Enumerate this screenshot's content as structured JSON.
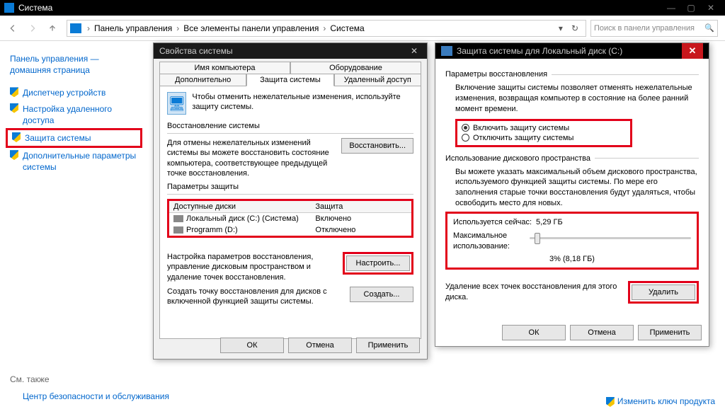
{
  "window": {
    "title": "Система"
  },
  "nav": {
    "crumbs": [
      "Панель управления",
      "Все элементы панели управления",
      "Система"
    ],
    "search_placeholder": "Поиск в панели управления"
  },
  "sidebar": {
    "home": "Панель управления — домашняя страница",
    "links": [
      "Диспетчер устройств",
      "Настройка удаленного доступа",
      "Защита системы",
      "Дополнительные параметры системы"
    ],
    "footer_heading": "См. также",
    "footer_link": "Центр безопасности и обслуживания"
  },
  "change_key": "Изменить ключ продукта",
  "dlg1": {
    "title": "Свойства системы",
    "tabs_row1": [
      "Имя компьютера",
      "Оборудование"
    ],
    "tabs_row2": [
      "Дополнительно",
      "Защита системы",
      "Удаленный доступ"
    ],
    "intro": "Чтобы отменить нежелательные изменения, используйте защиту системы.",
    "restore_group": "Восстановление системы",
    "restore_text": "Для отмены нежелательных изменений системы вы можете восстановить состояние компьютера, соответствующее предыдущей точке восстановления.",
    "restore_btn": "Восстановить...",
    "protect_group": "Параметры защиты",
    "table": {
      "col_a": "Доступные диски",
      "col_b": "Защита",
      "rows": [
        {
          "name": "Локальный диск (C:) (Система)",
          "state": "Включено"
        },
        {
          "name": "Programm (D:)",
          "state": "Отключено"
        }
      ]
    },
    "configure_text": "Настройка параметров восстановления, управление дисковым пространством и удаление точек восстановления.",
    "configure_btn": "Настроить...",
    "create_text": "Создать точку восстановления для дисков с включенной функцией защиты системы.",
    "create_btn": "Создать...",
    "ok": "ОК",
    "cancel": "Отмена",
    "apply": "Применить"
  },
  "dlg2": {
    "title": "Защита системы для Локальный диск (C:)",
    "restore_group": "Параметры восстановления",
    "restore_text": "Включение защиты системы позволяет отменять нежелательные изменения, возвращая компьютер в состояние на более ранний момент времени.",
    "radio_on": "Включить защиту системы",
    "radio_off": "Отключить защиту системы",
    "usage_group": "Использование дискового пространства",
    "usage_text": "Вы можете указать максимальный объем дискового пространства, используемого функцией защиты системы. По мере его заполнения старые точки восстановления будут удаляться, чтобы освободить место для новых.",
    "current_label": "Используется сейчас:",
    "current_value": "5,29 ГБ",
    "max_label": "Максимальное использование:",
    "slider_value": "3% (8,18 ГБ)",
    "delete_text": "Удаление всех точек восстановления для этого диска.",
    "delete_btn": "Удалить",
    "ok": "ОК",
    "cancel": "Отмена",
    "apply": "Применить"
  }
}
